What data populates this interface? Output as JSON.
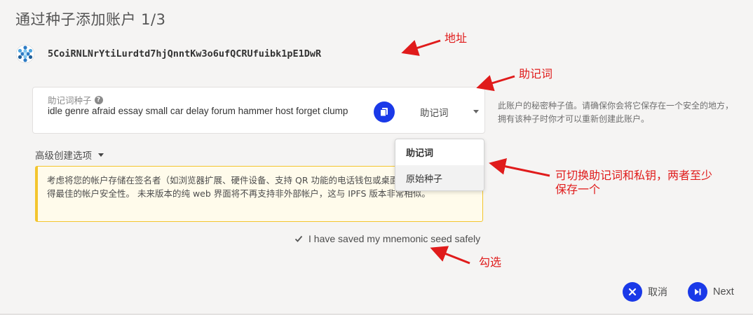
{
  "header": {
    "title": "通过种子添加账户 1/3"
  },
  "account": {
    "address": "5CoiRNLNrYtiLurdtd7hjQnntKw3o6ufQCRUfuibk1pE1DwR",
    "identicon": "polkadot-identicon"
  },
  "seed": {
    "label": "助记词种子",
    "value": "idle genre afraid essay small car delay forum hammer host forget clump",
    "type_selected": "助记词",
    "copy_icon": "copy-icon",
    "help_icon": "?"
  },
  "side_help": "此账户的秘密种子值。请确保你会将它保存在一个安全的地方，拥有该种子时你才可以重新创建此账户。",
  "advanced": {
    "label": "高级创建选项"
  },
  "warning": {
    "text": "考虑将您的帐户存储在签名者（如浏览器扩展、硬件设备、支持 QR 功能的电话钱包或桌面应用程序中，以获得最佳的帐户安全性。 未来版本的纯 web 界面将不再支持非外部帐户，这与 IPFS 版本非常相似。"
  },
  "dropdown": {
    "options": [
      {
        "label": "助记词",
        "selected": true
      },
      {
        "label": "原始种子",
        "selected": false
      }
    ]
  },
  "confirm": {
    "label": "I have saved my mnemonic seed safely",
    "checked": true
  },
  "buttons": {
    "cancel": "取消",
    "next": "Next"
  },
  "annotations": {
    "address": "地址",
    "mnemonic": "助记词",
    "switch_line1": "可切换助记词和私钥，两者至少",
    "switch_line2": "保存一个",
    "check": "勾选"
  },
  "colors": {
    "accent": "#1a39e8",
    "annotation": "#e01b1b",
    "warning_border": "#f3c52e"
  }
}
